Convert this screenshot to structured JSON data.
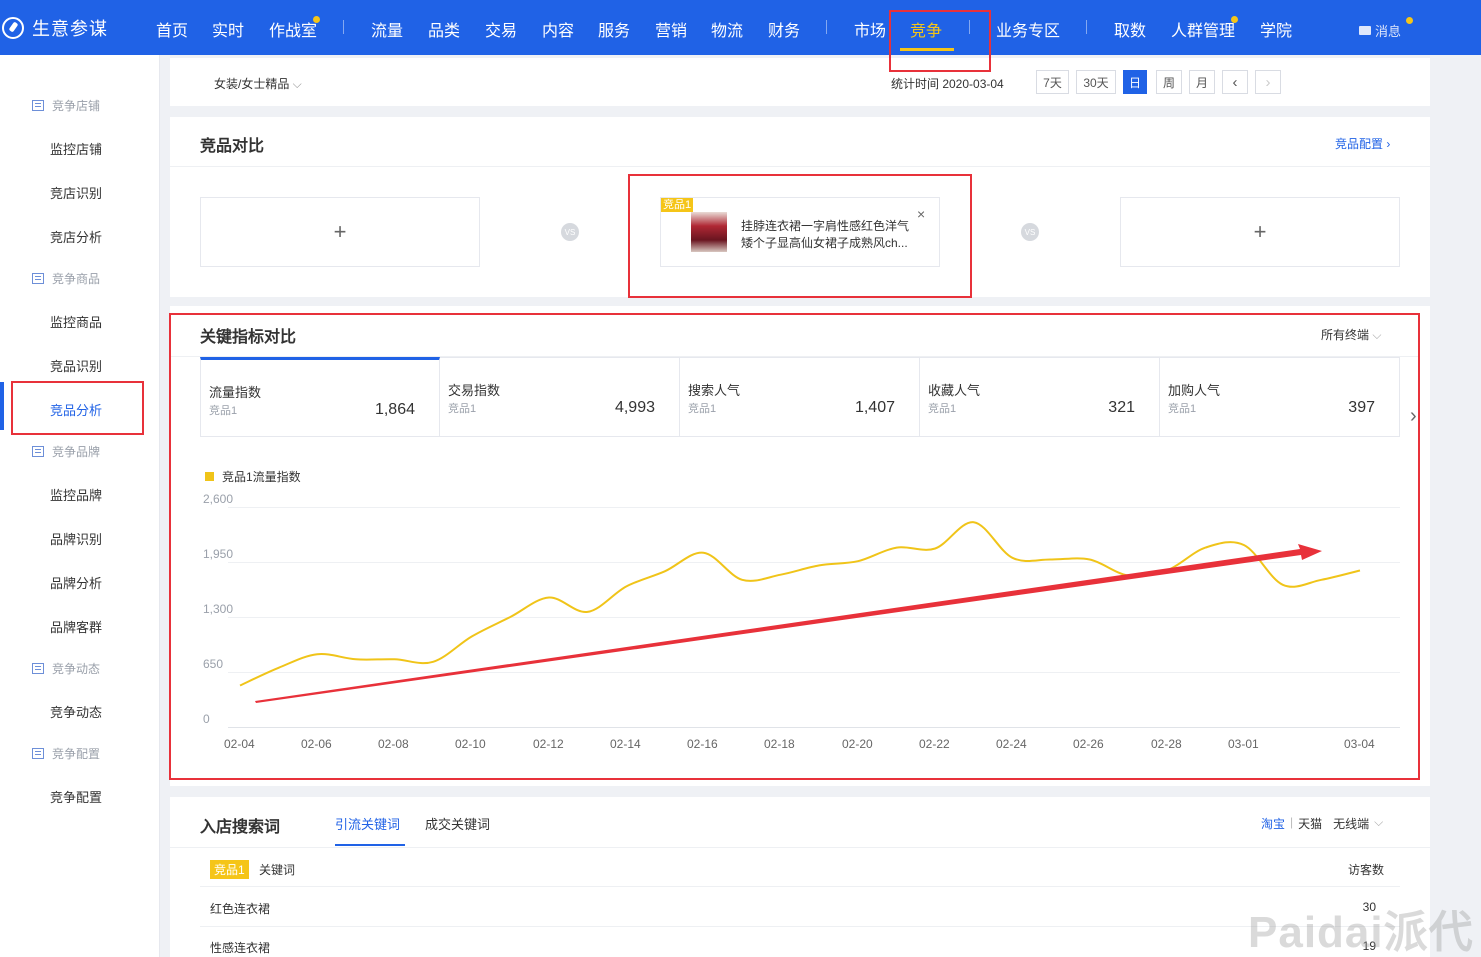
{
  "app": {
    "name": "生意参谋"
  },
  "nav": {
    "items": [
      "首页",
      "实时",
      "作战室",
      "流量",
      "品类",
      "交易",
      "内容",
      "服务",
      "营销",
      "物流",
      "财务",
      "市场",
      "竞争",
      "业务专区",
      "取数",
      "人群管理",
      "学院"
    ],
    "active": "竞争",
    "message": "消息"
  },
  "filter": {
    "category": "女装/女士精品",
    "stat_time_label": "统计时间 2020-03-04",
    "periods": [
      "7天",
      "30天",
      "日",
      "周",
      "月"
    ],
    "active_period": "日",
    "prev": "‹",
    "next": "›"
  },
  "sidebar": {
    "groups": [
      {
        "label": "竞争店铺",
        "items": [
          "监控店铺",
          "竞店识别",
          "竞店分析"
        ]
      },
      {
        "label": "竞争商品",
        "items": [
          "监控商品",
          "竞品识别",
          "竞品分析"
        ]
      },
      {
        "label": "竞争品牌",
        "items": [
          "监控品牌",
          "品牌识别",
          "品牌分析",
          "品牌客群"
        ]
      },
      {
        "label": "竞争动态",
        "items": [
          "竞争动态"
        ]
      },
      {
        "label": "竞争配置",
        "items": [
          "竞争配置"
        ]
      }
    ],
    "active_item": "竞品分析"
  },
  "compare": {
    "title": "竞品对比",
    "config_link": "竞品配置 ›",
    "add_symbol": "+",
    "vs": "VS",
    "product": {
      "tag": "竞品1",
      "name": "挂脖连衣裙一字肩性感红色洋气矮个子显高仙女裙子成熟风ch...",
      "close": "×"
    }
  },
  "metrics": {
    "title": "关键指标对比",
    "device": "所有终端",
    "more": "›",
    "cards": [
      {
        "label": "流量指数",
        "sub": "竞品1",
        "value": "1,864"
      },
      {
        "label": "交易指数",
        "sub": "竞品1",
        "value": "4,993"
      },
      {
        "label": "搜索人气",
        "sub": "竞品1",
        "value": "1,407"
      },
      {
        "label": "收藏人气",
        "sub": "竞品1",
        "value": "321"
      },
      {
        "label": "加购人气",
        "sub": "竞品1",
        "value": "397"
      }
    ]
  },
  "chart_data": {
    "type": "line",
    "legend": [
      "竞品1流量指数"
    ],
    "ylim": [
      0,
      2600
    ],
    "yticks": [
      "2,600",
      "1,950",
      "1,300",
      "650",
      "0"
    ],
    "xticks": [
      "02-04",
      "02-06",
      "02-08",
      "02-10",
      "02-12",
      "02-14",
      "02-16",
      "02-18",
      "02-20",
      "02-22",
      "02-24",
      "02-26",
      "02-28",
      "03-01",
      "03-04"
    ],
    "series": [
      {
        "name": "竞品1流量指数",
        "color": "#f0c419",
        "x": [
          "02-04",
          "02-05",
          "02-06",
          "02-07",
          "02-08",
          "02-09",
          "02-10",
          "02-11",
          "02-12",
          "02-13",
          "02-14",
          "02-15",
          "02-16",
          "02-17",
          "02-18",
          "02-19",
          "02-20",
          "02-21",
          "02-22",
          "02-23",
          "02-24",
          "02-25",
          "02-26",
          "02-27",
          "02-28",
          "02-29",
          "03-01",
          "03-02",
          "03-03",
          "03-04"
        ],
        "values": [
          490,
          700,
          860,
          800,
          800,
          770,
          1070,
          1300,
          1530,
          1360,
          1660,
          1840,
          2060,
          1740,
          1800,
          1910,
          1960,
          2120,
          2110,
          2420,
          2000,
          1980,
          1980,
          1790,
          1850,
          2120,
          2150,
          1680,
          1740,
          1850
        ]
      }
    ]
  },
  "keywords": {
    "title": "入店搜索词",
    "tabs": [
      "引流关键词",
      "成交关键词"
    ],
    "active_tab": "引流关键词",
    "platforms": [
      "淘宝",
      "天猫"
    ],
    "platform_sep": "|",
    "device": "无线端",
    "tag": "竞品1",
    "col_keyword": "关键词",
    "col_visitors": "访客数",
    "rows": [
      {
        "keyword": "红色连衣裙",
        "visitors": "30"
      },
      {
        "keyword": "性感连衣裙",
        "visitors": "19"
      }
    ]
  },
  "watermark": "Paidai派代"
}
